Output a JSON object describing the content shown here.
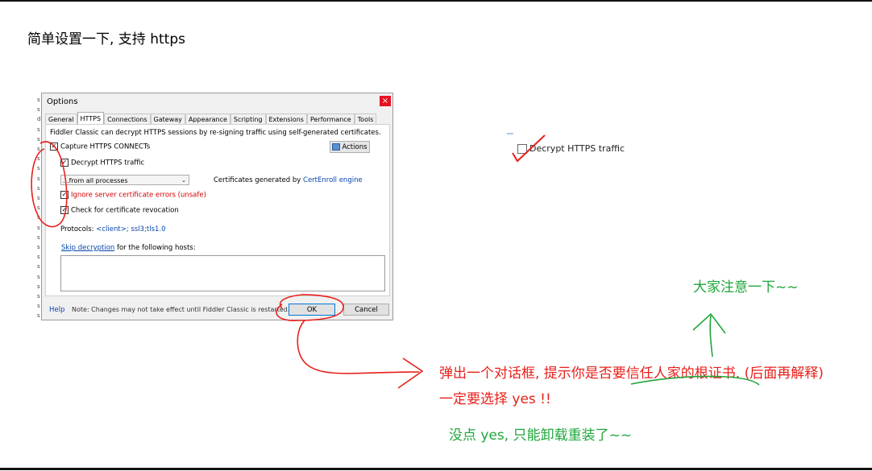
{
  "heading": "简单设置一下, 支持 https",
  "side_strip": [
    "s",
    "s",
    "d",
    "s",
    "s",
    "s",
    "s",
    "s",
    "s",
    "s",
    "s",
    "s",
    "s",
    "s",
    "s",
    "s",
    "s",
    "s",
    "s",
    "s",
    "s",
    "s",
    "s"
  ],
  "dialog": {
    "title": "Options",
    "close_glyph": "×",
    "tabs": [
      "General",
      "HTTPS",
      "Connections",
      "Gateway",
      "Appearance",
      "Scripting",
      "Extensions",
      "Performance",
      "Tools"
    ],
    "active_tab": "HTTPS",
    "intro": "Fiddler Classic can decrypt HTTPS sessions by re-signing traffic using self-generated certificates.",
    "capture_label": "Capture HTTPS CONNECTs",
    "capture_checked": true,
    "actions_label": "Actions",
    "decrypt_label": "Decrypt HTTPS traffic",
    "decrypt_checked": true,
    "process_select": "...from all processes",
    "cert_prefix": "Certificates generated by ",
    "cert_engine": "CertEnroll engine",
    "ignore_label": "Ignore server certificate errors (unsafe)",
    "ignore_checked": true,
    "revocation_label": "Check for certificate revocation",
    "revocation_checked": true,
    "protocols_prefix": "Protocols: ",
    "protocols_value": "<client>; ssl3;tls1.0",
    "skip_link": "Skip decryption",
    "skip_suffix": " for the following hosts:",
    "help": "Help",
    "note": "Note: Changes may not take effect until Fiddler Classic is restarted.",
    "ok": "OK",
    "cancel": "Cancel"
  },
  "right_checkbox": {
    "label": "Decrypt HTTPS traffic",
    "checked": false
  },
  "annotations": {
    "popup_line1": "弹出一个对话框, 提示你是否要信任人家的根证书. (后面再解释)",
    "popup_line2": "一定要选择   yes !!",
    "notice": "大家注意一下~~",
    "warning": "没点 yes, 只能卸载重装了~~"
  },
  "colors": {
    "annotation_red": "#e8201b",
    "annotation_green": "#1fa63a",
    "link": "#0645ad",
    "ok_border": "#0078d7"
  }
}
